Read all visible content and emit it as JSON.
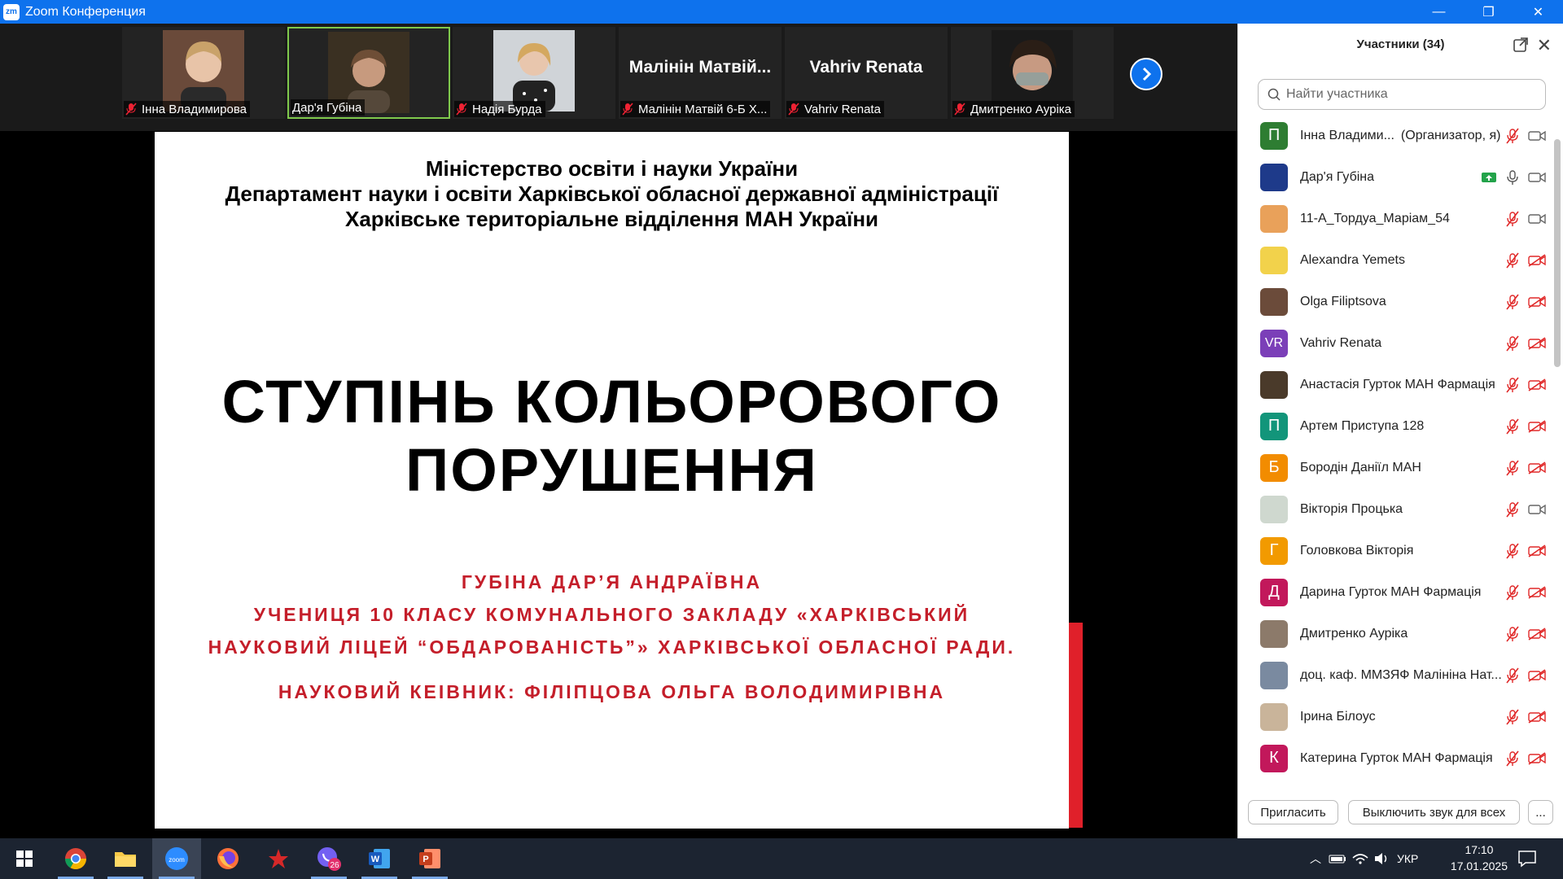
{
  "window": {
    "title": "Zoom Конференция",
    "logo_text": "zm",
    "controls": [
      "minimize",
      "maximize",
      "close"
    ]
  },
  "video_strip": {
    "tiles": [
      {
        "name": "Інна Владимирова",
        "muted": true,
        "kind": "photo"
      },
      {
        "name": "Дар'я Губіна",
        "muted": false,
        "kind": "photo",
        "active": true
      },
      {
        "name": "Надія Бурда",
        "muted": true,
        "kind": "photo"
      },
      {
        "name": "Малінін Матвій 6-Б Х...",
        "big_name": "Малінін Матвій...",
        "muted": true,
        "kind": "name"
      },
      {
        "name": "Vahriv Renata",
        "big_name": "Vahriv Renata",
        "muted": true,
        "kind": "name"
      },
      {
        "name": "Дмитренко Ауріка",
        "muted": true,
        "kind": "photo"
      }
    ],
    "next_icon": "chevron-right-icon"
  },
  "slide": {
    "header_lines": [
      "Міністерство освіти і науки України",
      "Департамент науки і освіти Харківської обласної державної адміністрації",
      "Харківське територіальне відділення МАН України"
    ],
    "title_lines": [
      "СТУПІНЬ КОЛЬОРОВОГО",
      "ПОРУШЕННЯ"
    ],
    "author": "ГУБІНА ДАР’Я АНДРАЇВНА",
    "school_line1": "УЧЕНИЦЯ 10 КЛАСУ КОМУНАЛЬНОГО ЗАКЛАДУ «ХАРКІВСЬКИЙ",
    "school_line2": "НАУКОВИЙ ЛІЦЕЙ “ОБДАРОВАНІСТЬ”» ХАРКІВСЬКОЇ ОБЛАСНОЇ РАДИ.",
    "supervisor": "НАУКОВИЙ КЕІВНИК: ФІЛІПЦОВА ОЛЬГА ВОЛОДИМИРІВНА"
  },
  "participants": {
    "title": "Участники (34)",
    "search_placeholder": "Найти участника",
    "items": [
      {
        "name": "Інна Владими...",
        "role": "(Организатор, я)",
        "avatar_letter": "П",
        "avatar_color": "#2e7d32",
        "mic": "muted",
        "video": "on"
      },
      {
        "name": "Дар'я Губіна",
        "role": "",
        "avatar_letter": "",
        "avatar_color": "#1e3a8a",
        "mic": "on",
        "video": "on",
        "sharing": true
      },
      {
        "name": "11-А_Тордуа_Маріам_54",
        "role": "",
        "avatar_letter": "",
        "avatar_color": "#e9a15a",
        "mic": "muted",
        "video": "on"
      },
      {
        "name": "Alexandra Yemets",
        "role": "",
        "avatar_letter": "",
        "avatar_color": "#f2d24b",
        "mic": "muted",
        "video": "off"
      },
      {
        "name": "Olga Filiptsova",
        "role": "",
        "avatar_letter": "",
        "avatar_color": "#6b4b3a",
        "mic": "muted",
        "video": "off"
      },
      {
        "name": "Vahriv Renata",
        "role": "",
        "avatar_letter": "VR",
        "avatar_color": "#7b3fb8",
        "mic": "muted",
        "video": "off"
      },
      {
        "name": "Анастасія Гурток МАН Фармація",
        "role": "",
        "avatar_letter": "",
        "avatar_color": "#4a3a2a",
        "mic": "muted",
        "video": "off"
      },
      {
        "name": "Артем Приступа 128",
        "role": "",
        "avatar_letter": "П",
        "avatar_color": "#12957a",
        "mic": "muted",
        "video": "off"
      },
      {
        "name": "Бородін Даніїл МАН",
        "role": "",
        "avatar_letter": "Б",
        "avatar_color": "#f28c00",
        "mic": "muted",
        "video": "off"
      },
      {
        "name": "Вікторія Процька",
        "role": "",
        "avatar_letter": "",
        "avatar_color": "#cfd8cf",
        "mic": "muted",
        "video": "on"
      },
      {
        "name": "Головкова Вікторія",
        "role": "",
        "avatar_letter": "Г",
        "avatar_color": "#f29a00",
        "mic": "muted",
        "video": "off"
      },
      {
        "name": "Дарина Гурток МАН Фармація",
        "role": "",
        "avatar_letter": "Д",
        "avatar_color": "#c2185b",
        "mic": "muted",
        "video": "off"
      },
      {
        "name": "Дмитренко Ауріка",
        "role": "",
        "avatar_letter": "",
        "avatar_color": "#8c7a6a",
        "mic": "muted",
        "video": "off"
      },
      {
        "name": "доц. каф. ММЗЯФ Малініна Нат...",
        "role": "",
        "avatar_letter": "",
        "avatar_color": "#7a8aa0",
        "mic": "muted",
        "video": "off"
      },
      {
        "name": "Ірина Білоус",
        "role": "",
        "avatar_letter": "",
        "avatar_color": "#c9b49a",
        "mic": "muted",
        "video": "off"
      },
      {
        "name": "Катерина Гурток МАН Фармація",
        "role": "",
        "avatar_letter": "К",
        "avatar_color": "#c2185b",
        "mic": "muted",
        "video": "off"
      }
    ],
    "invite_label": "Пригласить",
    "mute_all_label": "Выключить звук для всех",
    "more_label": "..."
  },
  "taskbar": {
    "apps": [
      {
        "name": "start-icon"
      },
      {
        "name": "chrome-icon"
      },
      {
        "name": "file-explorer-icon"
      },
      {
        "name": "zoom-icon",
        "active": true
      },
      {
        "name": "firefox-icon"
      },
      {
        "name": "app-icon"
      },
      {
        "name": "viber-icon",
        "badge": "26"
      },
      {
        "name": "word-icon"
      },
      {
        "name": "powerpoint-icon"
      }
    ],
    "language": "УКР",
    "time": "17:10",
    "date": "17.01.2025"
  }
}
